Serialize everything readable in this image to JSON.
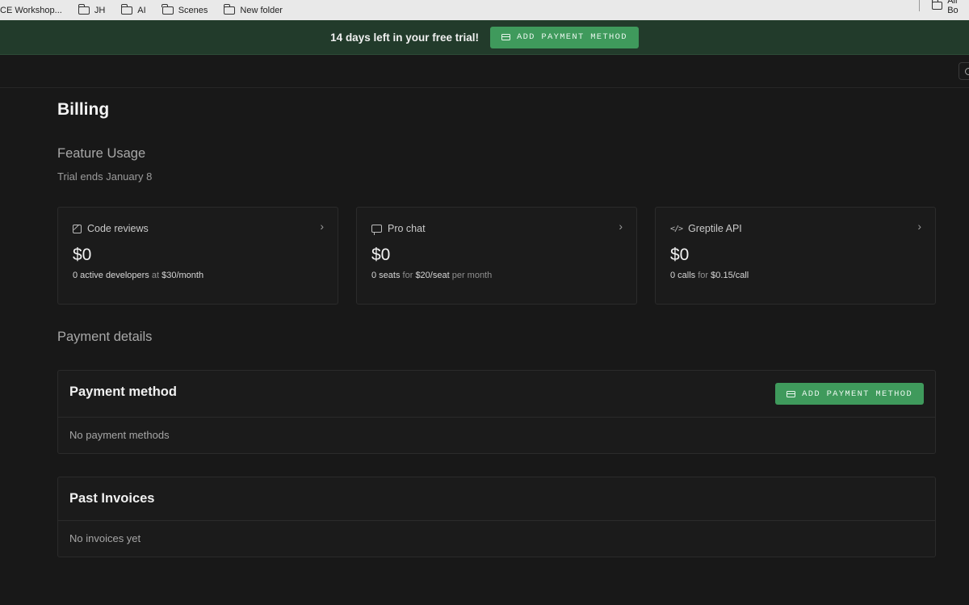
{
  "bookmarks": {
    "items": [
      {
        "label": "CE Workshop...",
        "icon": "folder-icon"
      },
      {
        "label": "JH",
        "icon": "folder-icon"
      },
      {
        "label": "AI",
        "icon": "folder-icon"
      },
      {
        "label": "Scenes",
        "icon": "folder-icon"
      },
      {
        "label": "New folder",
        "icon": "folder-icon"
      }
    ],
    "all_bookmarks": "All Bo"
  },
  "banner": {
    "text": "14 days left in your free trial!",
    "button_label": "ADD PAYMENT METHOD"
  },
  "page": {
    "title": "Billing"
  },
  "feature_usage": {
    "heading": "Feature Usage",
    "trial_note": "Trial ends January 8",
    "cards": [
      {
        "title": "Code reviews",
        "icon": "edit-icon",
        "price": "$0",
        "count": "0 active developers",
        "joiner": "at",
        "rate": "$30/month",
        "suffix": ""
      },
      {
        "title": "Pro chat",
        "icon": "chat-icon",
        "price": "$0",
        "count": "0 seats",
        "joiner": "for",
        "rate": "$20/seat",
        "suffix": "per month"
      },
      {
        "title": "Greptile API",
        "icon": "code-icon",
        "price": "$0",
        "count": "0 calls",
        "joiner": "for",
        "rate": "$0.15/call",
        "suffix": ""
      }
    ]
  },
  "payment_details": {
    "heading": "Payment details",
    "payment_method": {
      "title": "Payment method",
      "button_label": "ADD PAYMENT METHOD",
      "empty_text": "No payment methods"
    },
    "invoices": {
      "title": "Past Invoices",
      "empty_text": "No invoices yet"
    }
  },
  "colors": {
    "accent_green": "#3f9a5c",
    "banner_bg": "#223b2b",
    "page_bg": "#181818"
  }
}
